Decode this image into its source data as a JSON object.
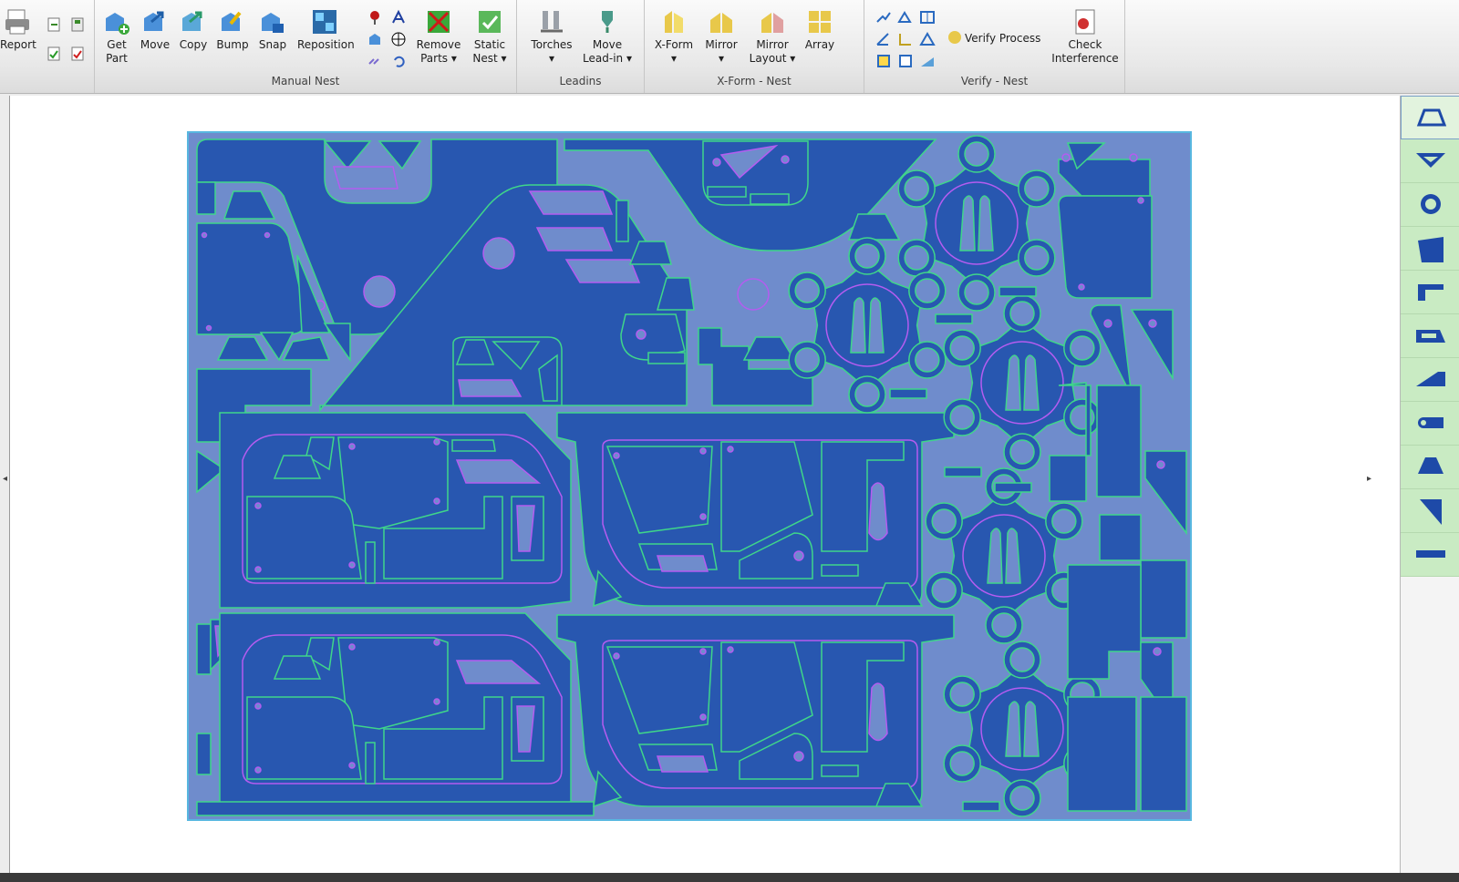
{
  "ribbon": {
    "report": {
      "label": "Report"
    },
    "manual_nest": {
      "group_label": "Manual Nest",
      "get_part": "Get\nPart",
      "move": "Move",
      "copy": "Copy",
      "bump": "Bump",
      "snap": "Snap",
      "reposition": "Reposition",
      "remove_parts": "Remove\nParts ▾",
      "static_nest": "Static\nNest ▾"
    },
    "leadins": {
      "group_label": "Leadins",
      "torches": "Torches\n▾",
      "move_leadin": "Move\nLead-in ▾"
    },
    "xform_nest": {
      "group_label": "X-Form - Nest",
      "xform": "X-Form\n▾",
      "mirror": "Mirror\n▾",
      "mirror_layout": "Mirror\nLayout ▾",
      "array": "Array"
    },
    "verify_nest": {
      "group_label": "Verify - Nest",
      "verify_process": "Verify Process",
      "check_interference": "Check\nInterference"
    }
  },
  "colors": {
    "sheet": "#6f8ccc",
    "part_fill": "#2857b0",
    "part_stroke": "#3fd68a",
    "hole_stroke": "#b45cf0",
    "hole_fill": "#6f8ccc"
  },
  "palette": {
    "icons": [
      "trapezoid-part-icon",
      "v-notch-part-icon",
      "gear-flange-part-icon",
      "quad-plate-part-icon",
      "l-bracket-part-icon",
      "slotted-plate-part-icon",
      "wedge-part-icon",
      "slot-lever-part-icon",
      "trapezoid-small-part-icon",
      "triangle-part-icon",
      "bar-part-icon"
    ],
    "selected": 0
  }
}
